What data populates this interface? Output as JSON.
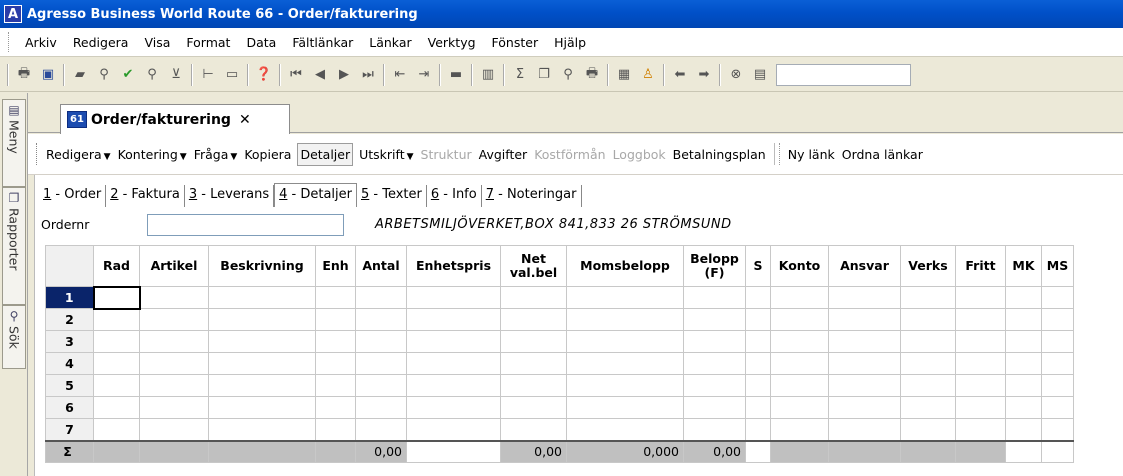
{
  "window": {
    "title": "Agresso Business World Route 66 - Order/fakturering",
    "app_icon": "A"
  },
  "menu": [
    "Arkiv",
    "Redigera",
    "Visa",
    "Format",
    "Data",
    "Fältlänkar",
    "Länkar",
    "Verktyg",
    "Fönster",
    "Hjälp"
  ],
  "sidebar": {
    "tabs": [
      "Meny",
      "Rapporter",
      "Sök"
    ]
  },
  "doc_tab": {
    "badge": "61",
    "label": "Order/fakturering",
    "close": "✕"
  },
  "actions": [
    {
      "label": "Redigera",
      "dropdown": true,
      "state": "normal"
    },
    {
      "label": "Kontering",
      "dropdown": true,
      "state": "normal"
    },
    {
      "label": "Fråga",
      "dropdown": true,
      "state": "normal"
    },
    {
      "label": "Kopiera",
      "dropdown": false,
      "state": "normal"
    },
    {
      "label": "Detaljer",
      "dropdown": false,
      "state": "active"
    },
    {
      "label": "Utskrift",
      "dropdown": true,
      "state": "normal"
    },
    {
      "label": "Struktur",
      "dropdown": false,
      "state": "disabled"
    },
    {
      "label": "Avgifter",
      "dropdown": false,
      "state": "normal"
    },
    {
      "label": "Kostförmån",
      "dropdown": false,
      "state": "disabled"
    },
    {
      "label": "Loggbok",
      "dropdown": false,
      "state": "disabled"
    },
    {
      "label": "Betalningsplan",
      "dropdown": false,
      "state": "normal"
    }
  ],
  "link_actions": [
    "Ny länk",
    "Ordna länkar"
  ],
  "subtabs": [
    {
      "key": "1",
      "label": " - Order"
    },
    {
      "key": "2",
      "label": " - Faktura"
    },
    {
      "key": "3",
      "label": " - Leverans"
    },
    {
      "key": "4",
      "label": " - Detaljer",
      "active": true
    },
    {
      "key": "5",
      "label": " - Texter"
    },
    {
      "key": "6",
      "label": " - Info"
    },
    {
      "key": "7",
      "label": " - Noteringar"
    }
  ],
  "order": {
    "label": "Ordernr",
    "value": "",
    "customer": "ARBETSMILJÖVERKET,BOX 841,833 26 STRÖMSUND"
  },
  "grid": {
    "columns": [
      "Rad",
      "Artikel",
      "Beskrivning",
      "Enh",
      "Antal",
      "Enhetspris",
      "Net val.bel",
      "Momsbelopp",
      "Belopp (F)",
      "S",
      "Konto",
      "Ansvar",
      "Verks",
      "Fritt",
      "MK",
      "MS"
    ],
    "rows": [
      "1",
      "2",
      "3",
      "4",
      "5",
      "6",
      "7"
    ],
    "sum_label": "Σ",
    "sums": {
      "Antal": "0,00",
      "Net val.bel": "0,00",
      "Momsbelopp": "0,000",
      "Belopp (F)": "0,00"
    }
  }
}
